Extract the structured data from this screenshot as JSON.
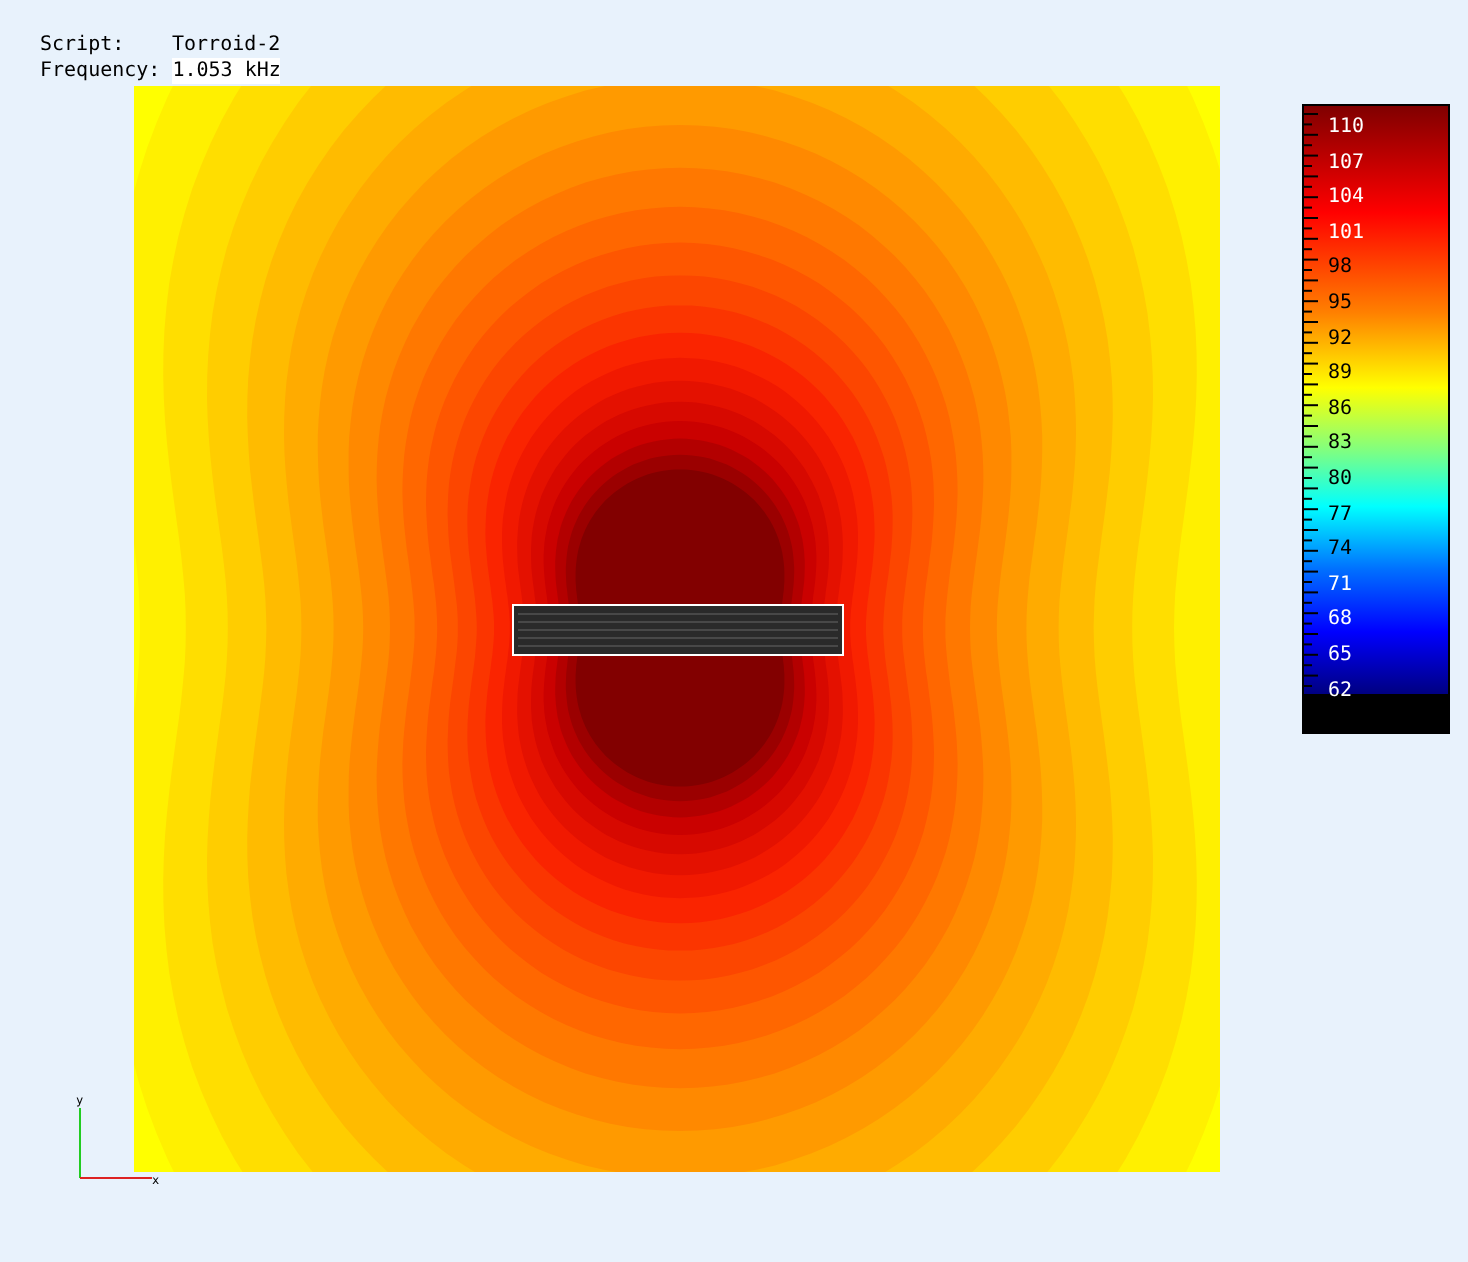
{
  "header": {
    "script_label": "Script:",
    "script_value": "Torroid-2",
    "frequency_label": "Frequency:",
    "frequency_value": "1.053 kHz"
  },
  "colorbar": {
    "labels": [
      "110",
      "107",
      "104",
      "101",
      "98",
      "95",
      "92",
      "89",
      "86",
      "83",
      "80",
      "77",
      "74",
      "71",
      "68",
      "65",
      "62"
    ]
  },
  "axes": {
    "x_label": "x",
    "y_label": "y"
  }
}
